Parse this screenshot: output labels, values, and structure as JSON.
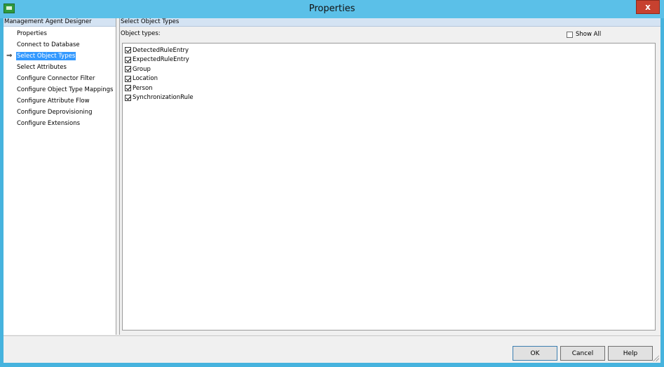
{
  "window": {
    "title": "Properties",
    "close_label": "x"
  },
  "left_panel": {
    "header": "Management Agent Designer",
    "items": [
      {
        "label": "Properties"
      },
      {
        "label": "Connect to Database"
      },
      {
        "label": "Select Object Types",
        "active": true
      },
      {
        "label": "Select Attributes"
      },
      {
        "label": "Configure Connector Filter"
      },
      {
        "label": "Configure Object Type Mappings"
      },
      {
        "label": "Configure Attribute Flow"
      },
      {
        "label": "Configure Deprovisioning"
      },
      {
        "label": "Configure Extensions"
      }
    ],
    "active_marker": "⇒"
  },
  "right_panel": {
    "header": "Select Object Types",
    "object_types_label": "Object types:",
    "show_all_label": "Show All",
    "show_all_checked": false,
    "object_types": [
      {
        "label": "DetectedRuleEntry",
        "checked": true
      },
      {
        "label": "ExpectedRuleEntry",
        "checked": true
      },
      {
        "label": "Group",
        "checked": true
      },
      {
        "label": "Location",
        "checked": true
      },
      {
        "label": "Person",
        "checked": true
      },
      {
        "label": "SynchronizationRule",
        "checked": true
      }
    ]
  },
  "buttons": {
    "ok": "OK",
    "cancel": "Cancel",
    "help": "Help"
  },
  "colors": {
    "title_bar": "#5bc0e8",
    "selection": "#3399ff",
    "close_button": "#c7412f",
    "header_band": "#d4e3f3"
  }
}
